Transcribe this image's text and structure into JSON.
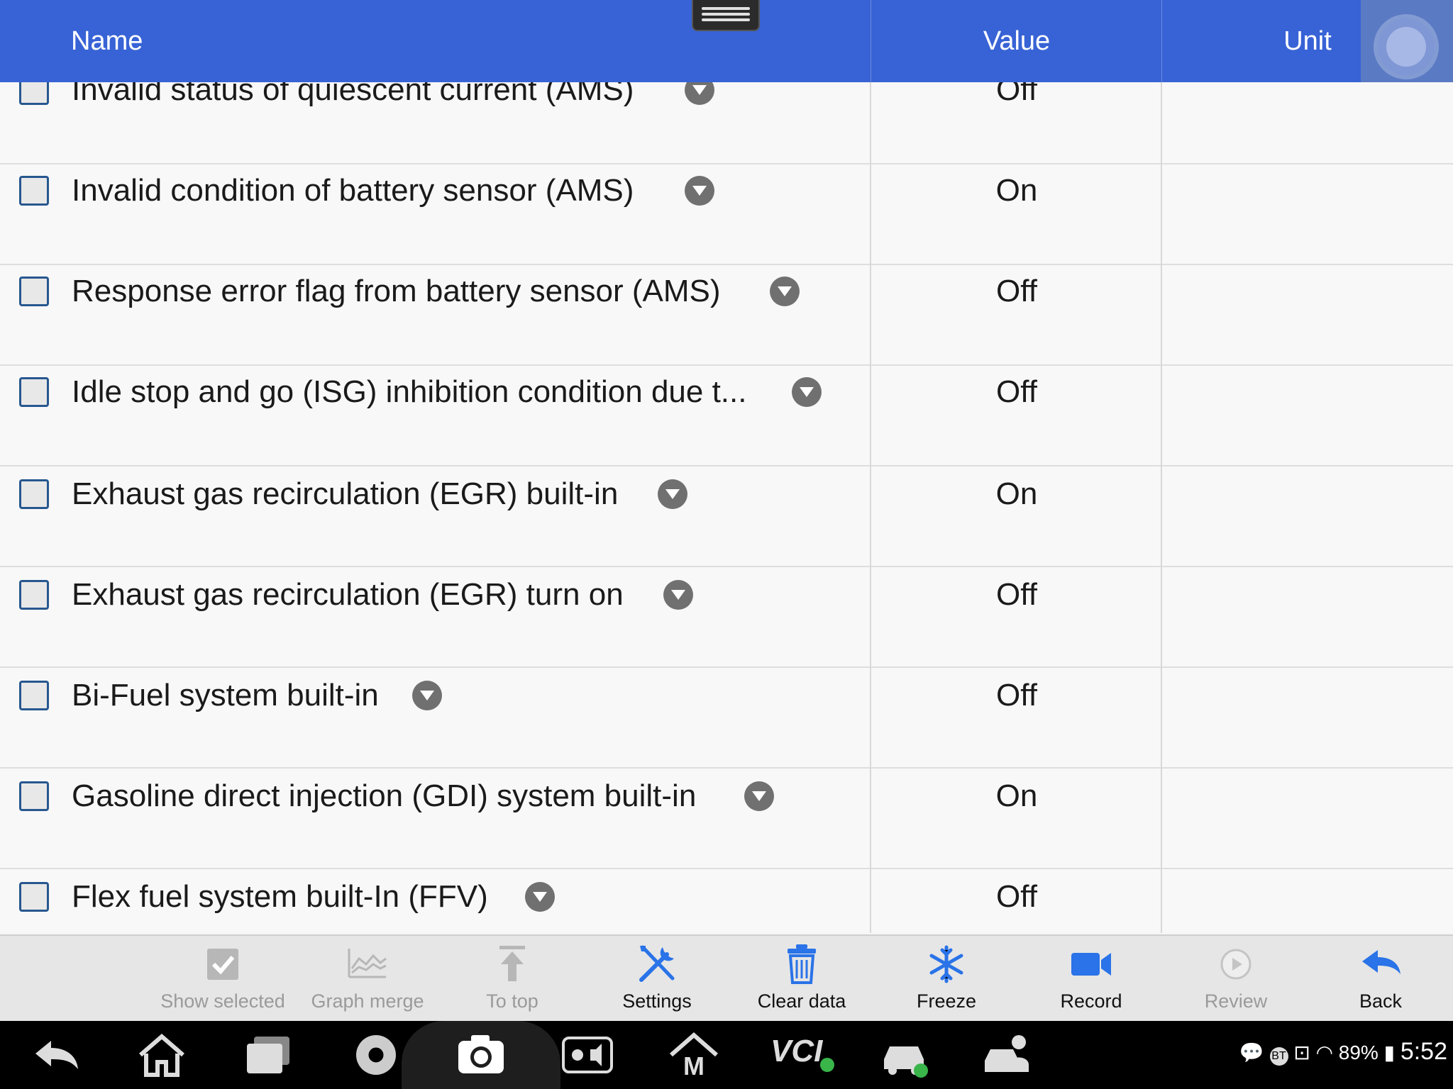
{
  "header": {
    "name": "Name",
    "value": "Value",
    "unit": "Unit"
  },
  "rows": [
    {
      "name": "Invalid status of quiescent current (AMS)",
      "value": "Off",
      "unit": ""
    },
    {
      "name": "Invalid condition of battery sensor (AMS)",
      "value": "On",
      "unit": ""
    },
    {
      "name": "Response error flag from battery sensor (AMS)",
      "value": "Off",
      "unit": ""
    },
    {
      "name": "Idle stop and go (ISG) inhibition condition due t...",
      "value": "Off",
      "unit": ""
    },
    {
      "name": "Exhaust gas recirculation (EGR) built-in",
      "value": "On",
      "unit": ""
    },
    {
      "name": "Exhaust gas recirculation (EGR) turn on",
      "value": "Off",
      "unit": ""
    },
    {
      "name": "Bi-Fuel system built-in",
      "value": "Off",
      "unit": ""
    },
    {
      "name": "Gasoline direct injection (GDI) system built-in",
      "value": "On",
      "unit": ""
    },
    {
      "name": "Flex fuel system built-In (FFV)",
      "value": "Off",
      "unit": ""
    }
  ],
  "toolbar": {
    "show_selected": "Show selected",
    "graph_merge": "Graph merge",
    "to_top": "To top",
    "settings": "Settings",
    "clear_data": "Clear data",
    "freeze": "Freeze",
    "record": "Record",
    "review": "Review",
    "back": "Back"
  },
  "navbar": {
    "icons": [
      "back-icon",
      "home-icon",
      "recent-apps-icon",
      "chrome-icon",
      "camera-icon",
      "brightness-volume-icon",
      "maxifix-icon",
      "vci-icon",
      "car-check-icon",
      "car-service-icon"
    ],
    "vci_label": "VCI",
    "battery": "89%",
    "time": "5:52",
    "bt_label": "BT"
  },
  "colors": {
    "header": "#3863d6",
    "accent": "#2a73e8",
    "toolbar": "#e6e6e6"
  }
}
